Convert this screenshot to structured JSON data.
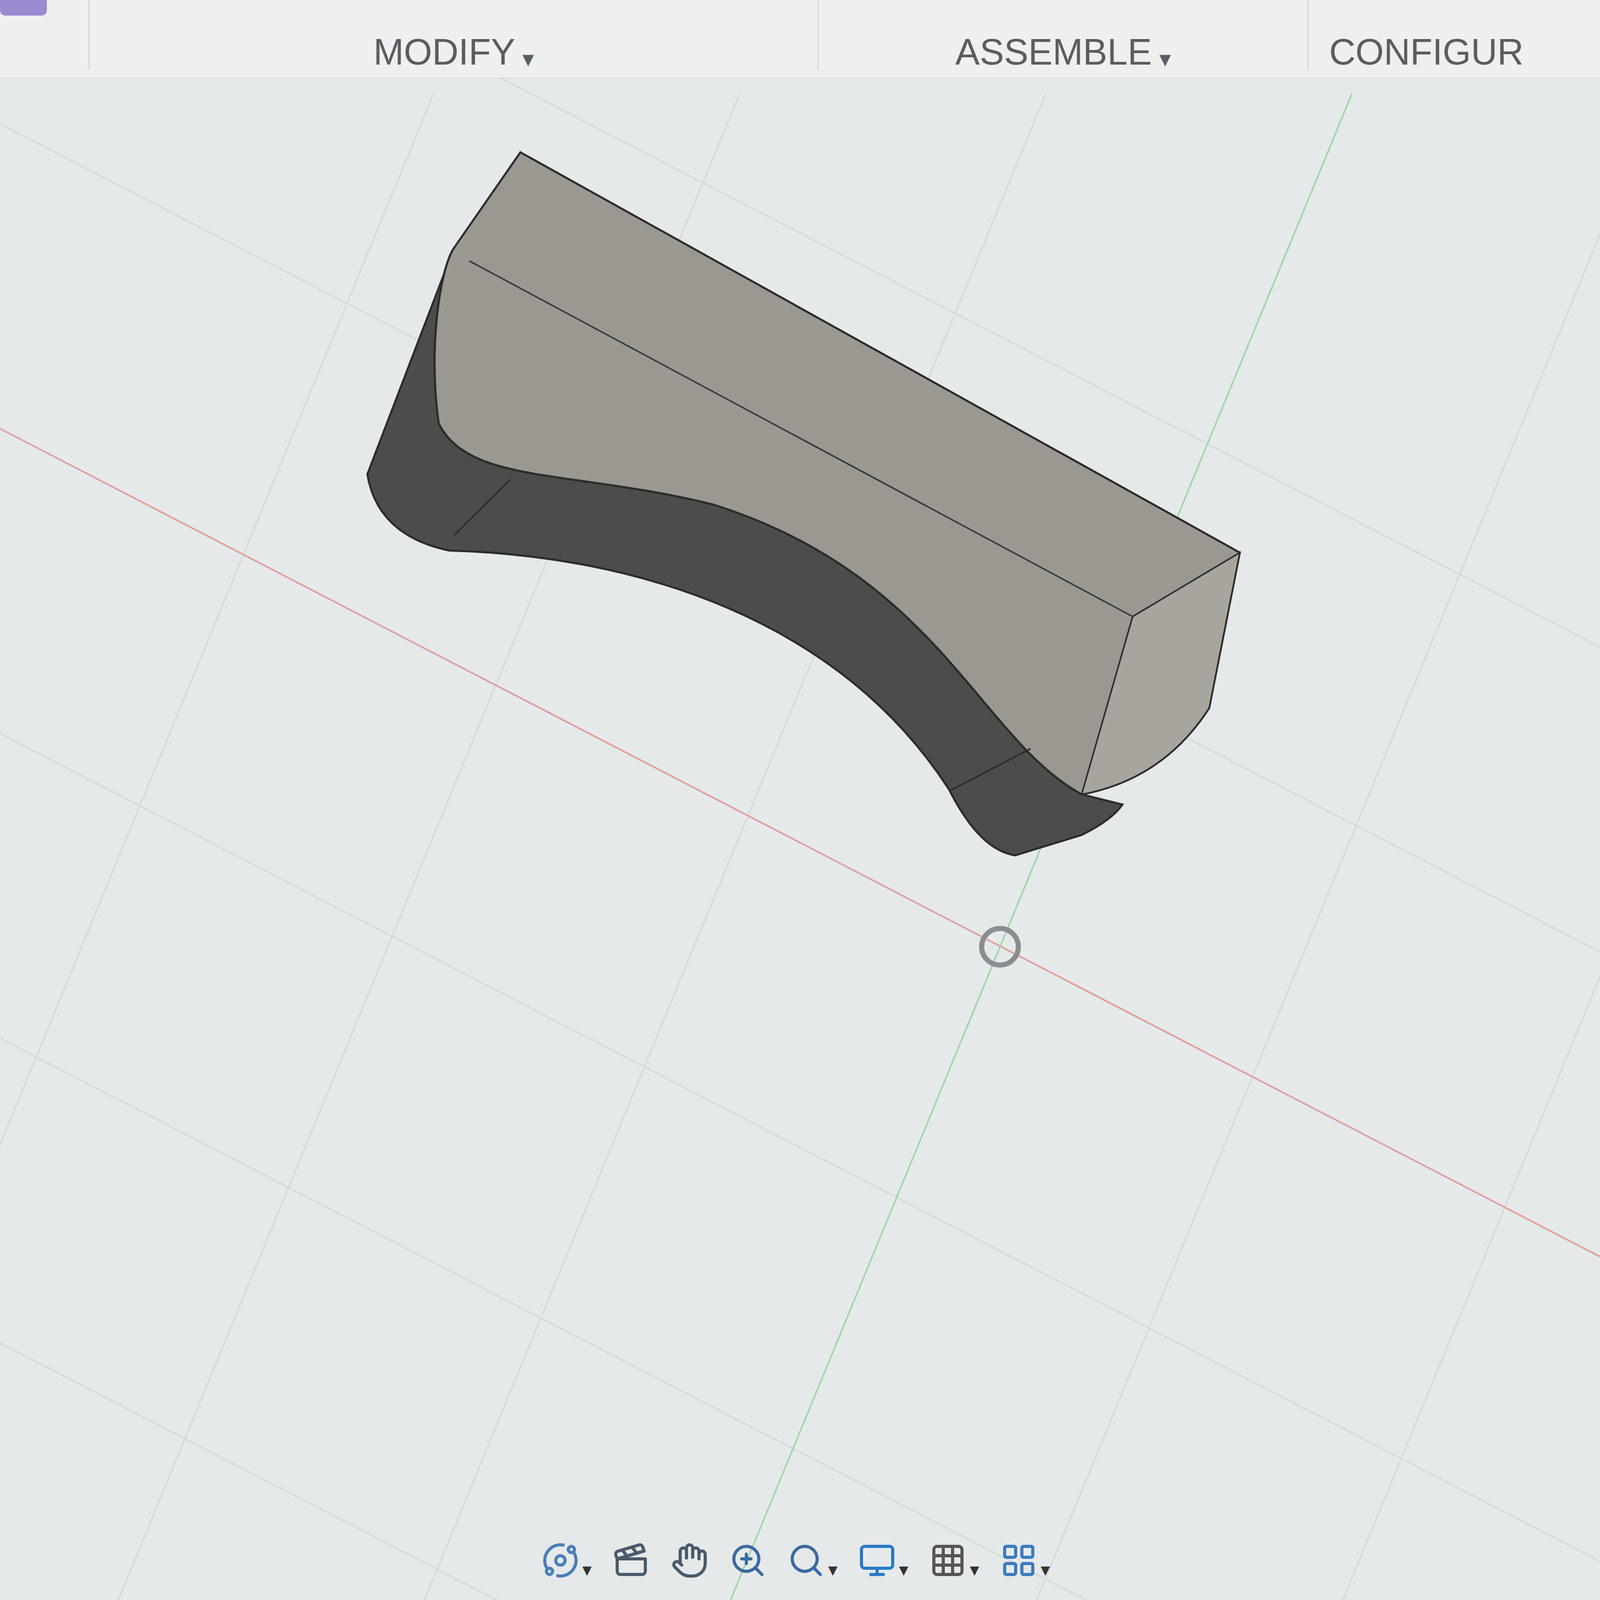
{
  "toolbar": {
    "menus": [
      {
        "label": "MODIFY",
        "arrow": "▾"
      },
      {
        "label": "ASSEMBLE",
        "arrow": "▾"
      },
      {
        "label": "CONFIGUR",
        "arrow": ""
      }
    ]
  },
  "navigation_bar": {
    "tools": [
      {
        "kind": "orbit",
        "arrow": "▾"
      },
      {
        "kind": "look",
        "arrow": ""
      },
      {
        "kind": "pan",
        "arrow": ""
      },
      {
        "kind": "zoom",
        "arrow": ""
      },
      {
        "kind": "fit",
        "arrow": "▾"
      },
      {
        "kind": "display",
        "arrow": "▾"
      },
      {
        "kind": "grid",
        "arrow": "▾"
      },
      {
        "kind": "viewports",
        "arrow": "▾"
      }
    ]
  }
}
